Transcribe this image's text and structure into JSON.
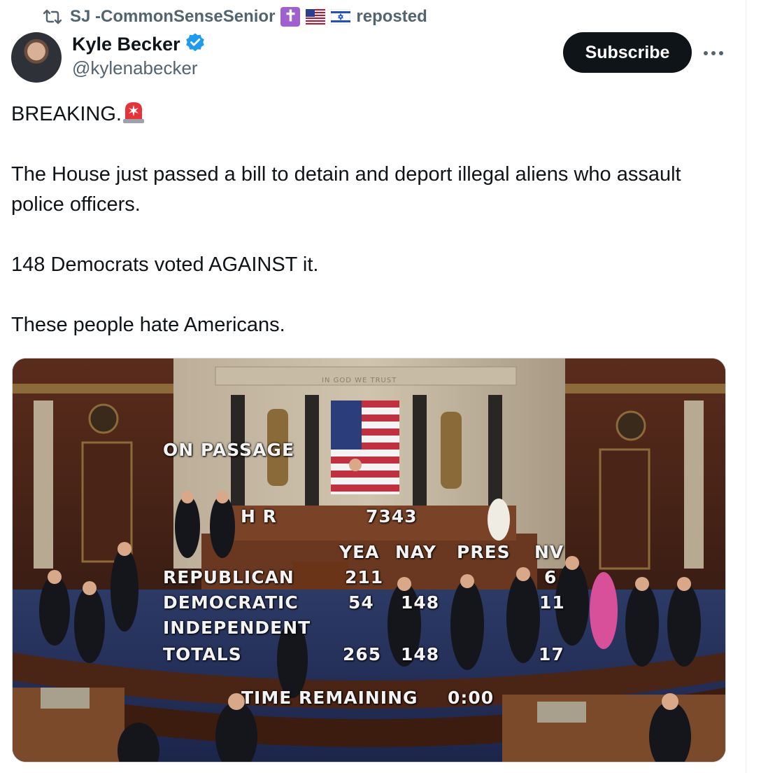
{
  "repost": {
    "name": "SJ -CommonSenseSenior",
    "action": "reposted",
    "icon": "repost-icon"
  },
  "author": {
    "display_name": "Kyle Becker",
    "handle": "@kylenabecker",
    "verified": true
  },
  "actions": {
    "subscribe_label": "Subscribe",
    "more_icon": "more-icon"
  },
  "tweet": {
    "line1": "BREAKING.",
    "line2": "The House just passed a bill to detain and deport illegal aliens who assault police officers.",
    "line3": "148 Democrats voted AGAINST it.",
    "line4": "These people hate Americans."
  },
  "vote_board": {
    "title": "ON PASSAGE",
    "bill_prefix": "H R",
    "bill_number": "7343",
    "headers": [
      "YEA",
      "NAY",
      "PRES",
      "NV"
    ],
    "rows": [
      {
        "party": "REPUBLICAN",
        "yea": "211",
        "nay": "",
        "pres": "",
        "nv": "6"
      },
      {
        "party": "DEMOCRATIC",
        "yea": "54",
        "nay": "148",
        "pres": "",
        "nv": "11"
      },
      {
        "party": "INDEPENDENT",
        "yea": "",
        "nay": "",
        "pres": "",
        "nv": ""
      },
      {
        "party": "TOTALS",
        "yea": "265",
        "nay": "148",
        "pres": "",
        "nv": "17"
      }
    ],
    "time_label": "TIME REMAINING",
    "time_value": "0:00",
    "motto": "IN GOD WE TRUST"
  },
  "colors": {
    "text": "#0f1419",
    "secondary": "#536471",
    "verified": "#1d9bf0",
    "button_bg": "#0f1419"
  }
}
